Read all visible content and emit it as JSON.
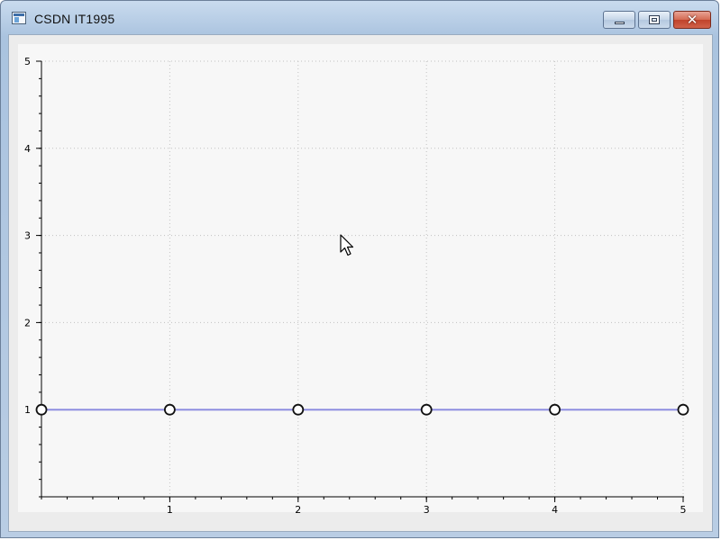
{
  "window": {
    "title": "CSDN IT1995",
    "icon": "app-window-icon",
    "controls": [
      {
        "name": "minimize",
        "icon": "minimize-icon"
      },
      {
        "name": "maximize",
        "icon": "maximize-icon"
      },
      {
        "name": "close",
        "icon": "close-icon",
        "glyph": "✕"
      }
    ]
  },
  "chart_data": {
    "type": "line",
    "title": "",
    "xlabel": "",
    "ylabel": "",
    "xlim": [
      0,
      5
    ],
    "ylim": [
      0,
      5
    ],
    "xticks": [
      1,
      2,
      3,
      4,
      5
    ],
    "yticks": [
      1,
      2,
      3,
      4,
      5
    ],
    "grid": true,
    "series": [
      {
        "x": [
          0,
          1,
          2,
          3,
          4,
          5
        ],
        "y": [
          1,
          1,
          1,
          1,
          1,
          1
        ],
        "line_color": "#8e8ee0",
        "marker": "open-circle",
        "marker_edge": "#111111",
        "marker_fill": "#ffffff"
      }
    ]
  },
  "colors": {
    "plot_background": "#f7f7f7",
    "window_frame": "#aac3df",
    "grid": "#c2c2c2",
    "axis": "#000000"
  },
  "cursor": {
    "icon": "mouse-pointer-icon"
  }
}
